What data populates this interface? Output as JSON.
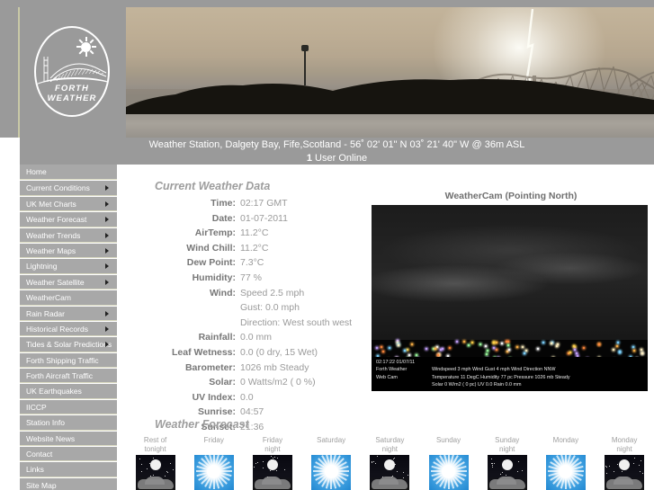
{
  "site": {
    "logo_line1": "FORTH",
    "logo_line2": "WEATHER",
    "station_caption": "Weather Station, Dalgety Bay, Fife,Scotland - 56˚ 02' 01\" N   03˚ 21' 40\" W @ 36m ASL",
    "users_count": "1",
    "users_text": " User Online"
  },
  "sidebar": {
    "items": [
      {
        "label": "Home",
        "arrow": false
      },
      {
        "label": "Current Conditions",
        "arrow": true
      },
      {
        "label": "UK Met Charts",
        "arrow": true
      },
      {
        "label": "Weather Forecast",
        "arrow": true
      },
      {
        "label": "Weather Trends",
        "arrow": true
      },
      {
        "label": "Weather Maps",
        "arrow": true
      },
      {
        "label": "Lightning",
        "arrow": true
      },
      {
        "label": "Weather Satellite",
        "arrow": true
      },
      {
        "label": "WeatherCam",
        "arrow": false
      },
      {
        "label": "Rain Radar",
        "arrow": true
      },
      {
        "label": "Historical Records",
        "arrow": true
      },
      {
        "label": "Tides & Solar Predictions",
        "arrow": true
      },
      {
        "label": "Forth Shipping Traffic",
        "arrow": false
      },
      {
        "label": "Forth Aircraft Traffic",
        "arrow": false
      },
      {
        "label": "UK Earthquakes",
        "arrow": false
      },
      {
        "label": "IICCP",
        "arrow": false
      },
      {
        "label": "Station Info",
        "arrow": false
      },
      {
        "label": "Website News",
        "arrow": false
      },
      {
        "label": "Contact",
        "arrow": false
      },
      {
        "label": "Links",
        "arrow": false
      },
      {
        "label": "Site Map",
        "arrow": false
      }
    ]
  },
  "current_weather": {
    "title": "Current Weather Data",
    "rows": [
      {
        "label": "Time:",
        "value": "02:17 GMT",
        "sub": false
      },
      {
        "label": "Date:",
        "value": "01-07-2011",
        "sub": false
      },
      {
        "label": "AirTemp:",
        "value": "11.2°C",
        "sub": false
      },
      {
        "label": "Wind Chill:",
        "value": "11.2°C",
        "sub": false
      },
      {
        "label": "Dew Point:",
        "value": "7.3°C",
        "sub": false
      },
      {
        "label": "Humidity:",
        "value": "77 %",
        "sub": false
      },
      {
        "label": "Wind:",
        "value": "Speed 2.5 mph",
        "sub": false
      },
      {
        "label": "",
        "value": "Gust: 0.0 mph",
        "sub": true
      },
      {
        "label": "",
        "value": "Direction: West south west",
        "sub": true
      },
      {
        "label": "Rainfall:",
        "value": "0.0 mm",
        "sub": false
      },
      {
        "label": "Leaf Wetness:",
        "value": "0.0 (0 dry, 15 Wet)",
        "sub": false
      },
      {
        "label": "Barometer:",
        "value": "1026 mb Steady",
        "sub": false
      },
      {
        "label": "Solar:",
        "value": "0 Watts/m2 ( 0 %)",
        "sub": false
      },
      {
        "label": "UV Index:",
        "value": "0.0",
        "sub": false
      },
      {
        "label": "Sunrise:",
        "value": "04:57",
        "sub": false
      },
      {
        "label": "Sunset:",
        "value": "21:36",
        "sub": false
      }
    ]
  },
  "webcam": {
    "title": "WeatherCam (Pointing North)",
    "osd_timestamp": "02:17:22  01/07/11",
    "osd_name_line1": "Forth Weather",
    "osd_name_line2": "Web Cam",
    "osd_line1": "Windspeed  3 mph   Wind Gust  4 mph   Wind Direction NNW",
    "osd_line2": "Temperature 11 DegC   Humidity 77 pc   Pressure 1026 mb Steady",
    "osd_line3": "Solar 0 W/m2 ( 0 pc)     UV 0.0    Rain  0.0 mm"
  },
  "forecast": {
    "title": "Weather Forecast",
    "days": [
      {
        "line1": "Rest of",
        "line2": "tonight",
        "icon": "night-partly-cloudy-icon",
        "type": "night"
      },
      {
        "line1": "Friday",
        "line2": "",
        "icon": "sunny-icon",
        "type": "day"
      },
      {
        "line1": "Friday",
        "line2": "night",
        "icon": "night-partly-cloudy-icon",
        "type": "night"
      },
      {
        "line1": "Saturday",
        "line2": "",
        "icon": "sunny-icon",
        "type": "day"
      },
      {
        "line1": "Saturday",
        "line2": "night",
        "icon": "night-partly-cloudy-icon",
        "type": "night"
      },
      {
        "line1": "Sunday",
        "line2": "",
        "icon": "sunny-icon",
        "type": "day"
      },
      {
        "line1": "Sunday",
        "line2": "night",
        "icon": "night-partly-cloudy-icon",
        "type": "night"
      },
      {
        "line1": "Monday",
        "line2": "",
        "icon": "sunny-icon",
        "type": "day"
      },
      {
        "line1": "Monday",
        "line2": "night",
        "icon": "night-partly-cloudy-icon",
        "type": "night"
      }
    ]
  },
  "colors": {
    "header_bg": "#9a9a9a",
    "nav_bg": "#a8a8a8",
    "nav_border": "#d8d8c0",
    "label_text": "#777777",
    "value_text": "#9a9a9a",
    "title_text": "#9d9d9d"
  }
}
